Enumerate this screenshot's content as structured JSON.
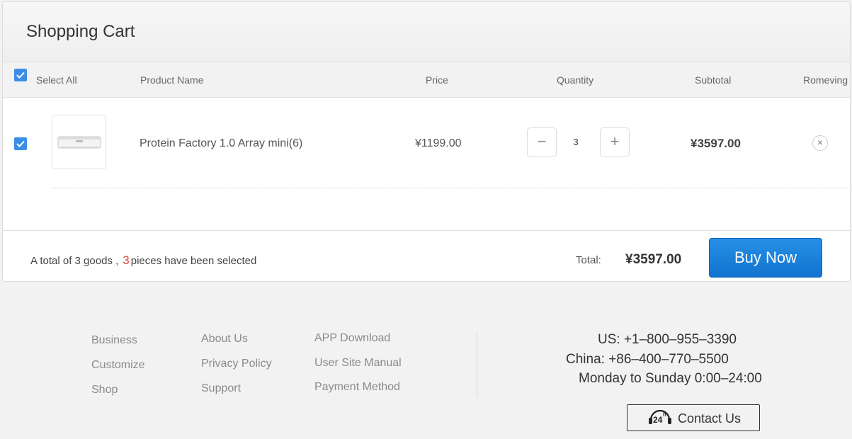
{
  "cart": {
    "title": "Shopping Cart",
    "columns": {
      "select_all": "Select All",
      "product_name": "Product Name",
      "price": "Price",
      "quantity": "Quantity",
      "subtotal": "Subtotal",
      "removing": "Romeving"
    },
    "items": [
      {
        "checked": true,
        "image_icon": "product-thumbnail-icon",
        "name": "Protein Factory 1.0 Array mini(6)",
        "price": "¥1199.00",
        "quantity": "3",
        "subtotal": "¥3597.00"
      }
    ],
    "footer": {
      "summary_prefix": "A total of 3 goods ,",
      "selected_count": "3",
      "summary_suffix": "pieces have been selected",
      "total_label": "Total:",
      "total_value": "¥3597.00",
      "buy_label": "Buy Now"
    }
  },
  "site_footer": {
    "col1": [
      "Business",
      "Customize",
      "Shop"
    ],
    "col2": [
      "About Us",
      "Privacy Policy",
      "Support"
    ],
    "col3": [
      "APP Download",
      "User Site Manual",
      "Payment Method"
    ],
    "contact": {
      "us": "US: +1–800–955–3390",
      "china": "China: +86–400–770–5500",
      "hours": "Monday to Sunday 0:00–24:00",
      "button_label": "Contact Us"
    }
  },
  "colors": {
    "accent": "#3a8ee6",
    "buy_button": "#1a80dc",
    "highlight_count": "#e0483c"
  }
}
